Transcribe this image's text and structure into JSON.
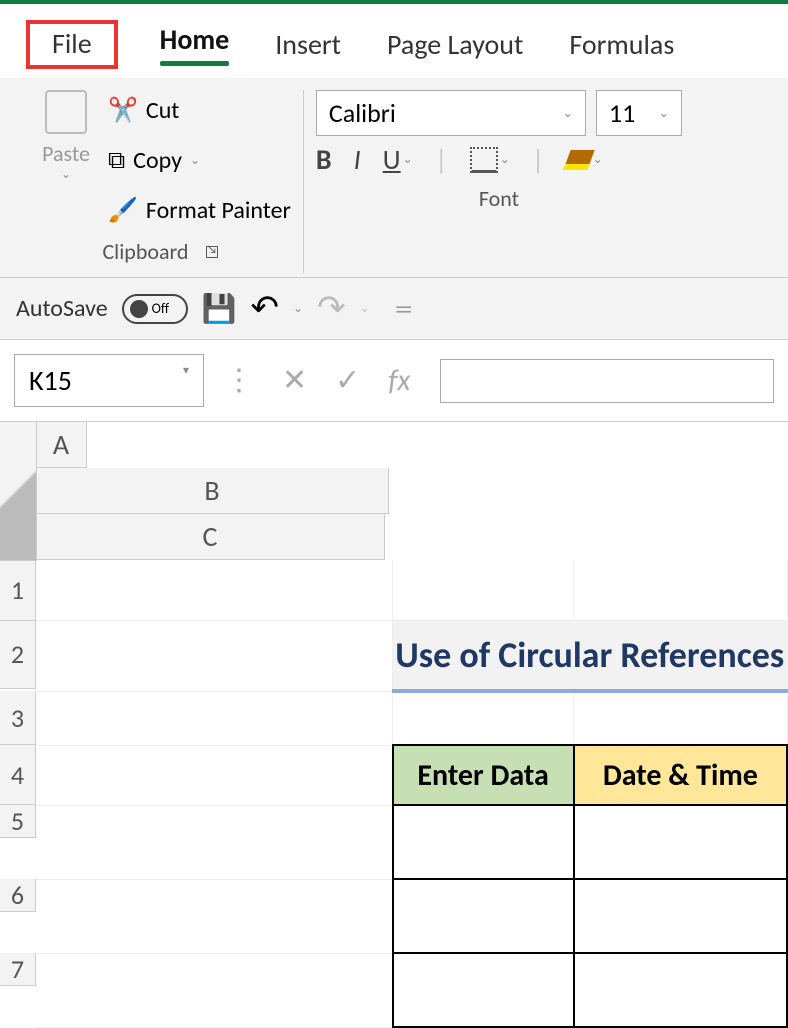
{
  "tabs": {
    "file": "File",
    "home": "Home",
    "insert": "Insert",
    "page_layout": "Page Layout",
    "formulas": "Formulas"
  },
  "clipboard": {
    "cut": "Cut",
    "copy": "Copy",
    "fmt": "Format Painter",
    "paste": "Paste",
    "title": "Clipboard"
  },
  "font": {
    "name": "Calibri",
    "size": "11",
    "bold": "B",
    "italic": "I",
    "underline": "U",
    "title": "Font"
  },
  "qat": {
    "autosave": "AutoSave",
    "off": "Off"
  },
  "namebox": {
    "ref": "K15",
    "fx": "fx"
  },
  "cols": {
    "a": "A",
    "b": "B",
    "c": "C"
  },
  "rows": {
    "r1": "1",
    "r2": "2",
    "r3": "3",
    "r4": "4",
    "r5": "5",
    "r6": "6",
    "r7": "7"
  },
  "sheet": {
    "title": "Use of Circular References",
    "hdr_b": "Enter Data",
    "hdr_c": "Date & Time"
  }
}
